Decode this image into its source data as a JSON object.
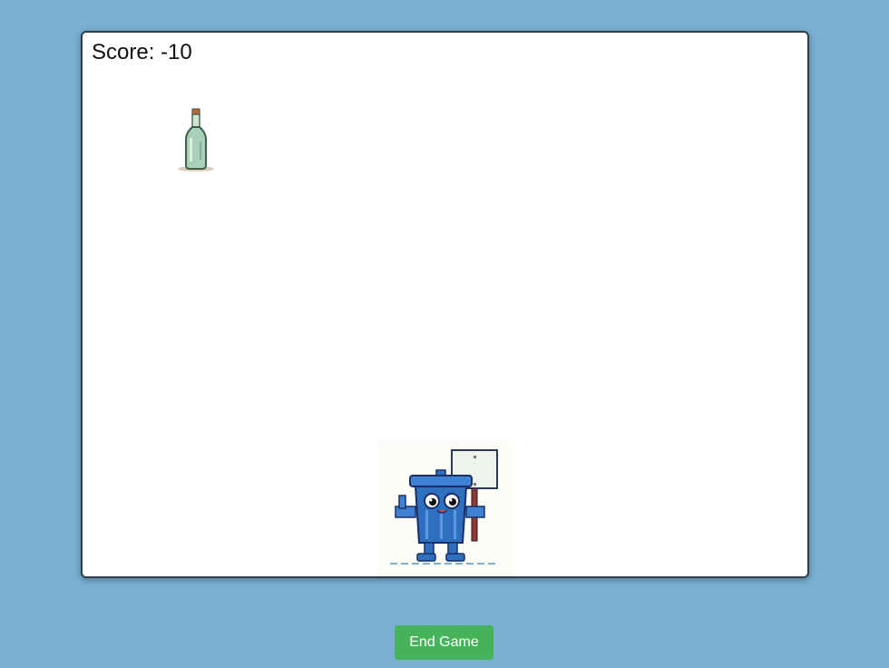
{
  "game": {
    "score_label": "Score:",
    "score_value": "-10",
    "items": [
      {
        "type": "bottle",
        "icon": "glass-bottle-icon"
      }
    ],
    "player": {
      "icon": "recycling-bin-mascot-icon"
    }
  },
  "controls": {
    "end_game_label": "End Game"
  },
  "colors": {
    "background": "#7ab0d4",
    "canvas": "#ffffff",
    "button": "#46b35a",
    "bin_blue": "#2f6fc0"
  }
}
